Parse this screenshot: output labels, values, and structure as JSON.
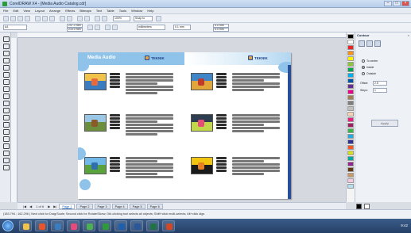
{
  "window": {
    "title": "CorelDRAW X4 - [Media Audio Catalog.cdr]",
    "minimize": "–",
    "maximize": "□",
    "close": "×"
  },
  "menu": [
    "File",
    "Edit",
    "View",
    "Layout",
    "Arrange",
    "Effects",
    "Bitmaps",
    "Text",
    "Table",
    "Tools",
    "Window",
    "Help"
  ],
  "toolbar": {
    "zoom": "100%",
    "snap": "Snap to",
    "page_size": "A4",
    "width": "297.0 mm",
    "height": "210.0 mm",
    "units": "millimeters",
    "nudge": "0.1 mm",
    "dup_x": "5.0 mm",
    "dup_y": "5.0 mm"
  },
  "document": {
    "section_title": "Media Audio",
    "logo_text": "TEKNIK",
    "logo_text_right": "TEKNIK"
  },
  "docker": {
    "title": "Contour",
    "options": [
      "To center",
      "Inside",
      "Outside"
    ],
    "offset_label": "Offset:",
    "offset_value": "2.5",
    "steps_label": "Steps:",
    "steps_value": "1",
    "apply": "Apply"
  },
  "pager": {
    "first": "|◀",
    "prev": "◀",
    "count": "1 of 6",
    "next": "▶",
    "last": "▶|",
    "tabs": [
      "Page 1",
      "Page 2",
      "Page 3",
      "Page 4",
      "Page 5",
      "Page 6"
    ]
  },
  "status": {
    "text": "(183.794 ; 162.296 )  Next click for Drag/Scale; Second click for Rotate/Skew; Dbl-clicking tool selects all objects; Shift+click multi-selects; Alt+click digs"
  },
  "taskbar": {
    "clock": "9:42"
  },
  "colors": {
    "accent": "#8fc3ea",
    "brand": "#1f3f86",
    "palette": [
      "#000000",
      "#ffffff",
      "#e8232a",
      "#f7931e",
      "#fff200",
      "#8dc63f",
      "#00a651",
      "#00aeef",
      "#0054a6",
      "#662d91",
      "#ec008c",
      "#a67c52",
      "#7f7f7f",
      "#c0c0c0",
      "#f9d3b6",
      "#ed1c7f",
      "#9e1f63",
      "#39b54a",
      "#27aae1",
      "#2e3192",
      "#f15a24",
      "#d7df23",
      "#00a99d",
      "#92278f",
      "#603813",
      "#c69c6d",
      "#f2c9e0",
      "#b3dff1"
    ]
  }
}
